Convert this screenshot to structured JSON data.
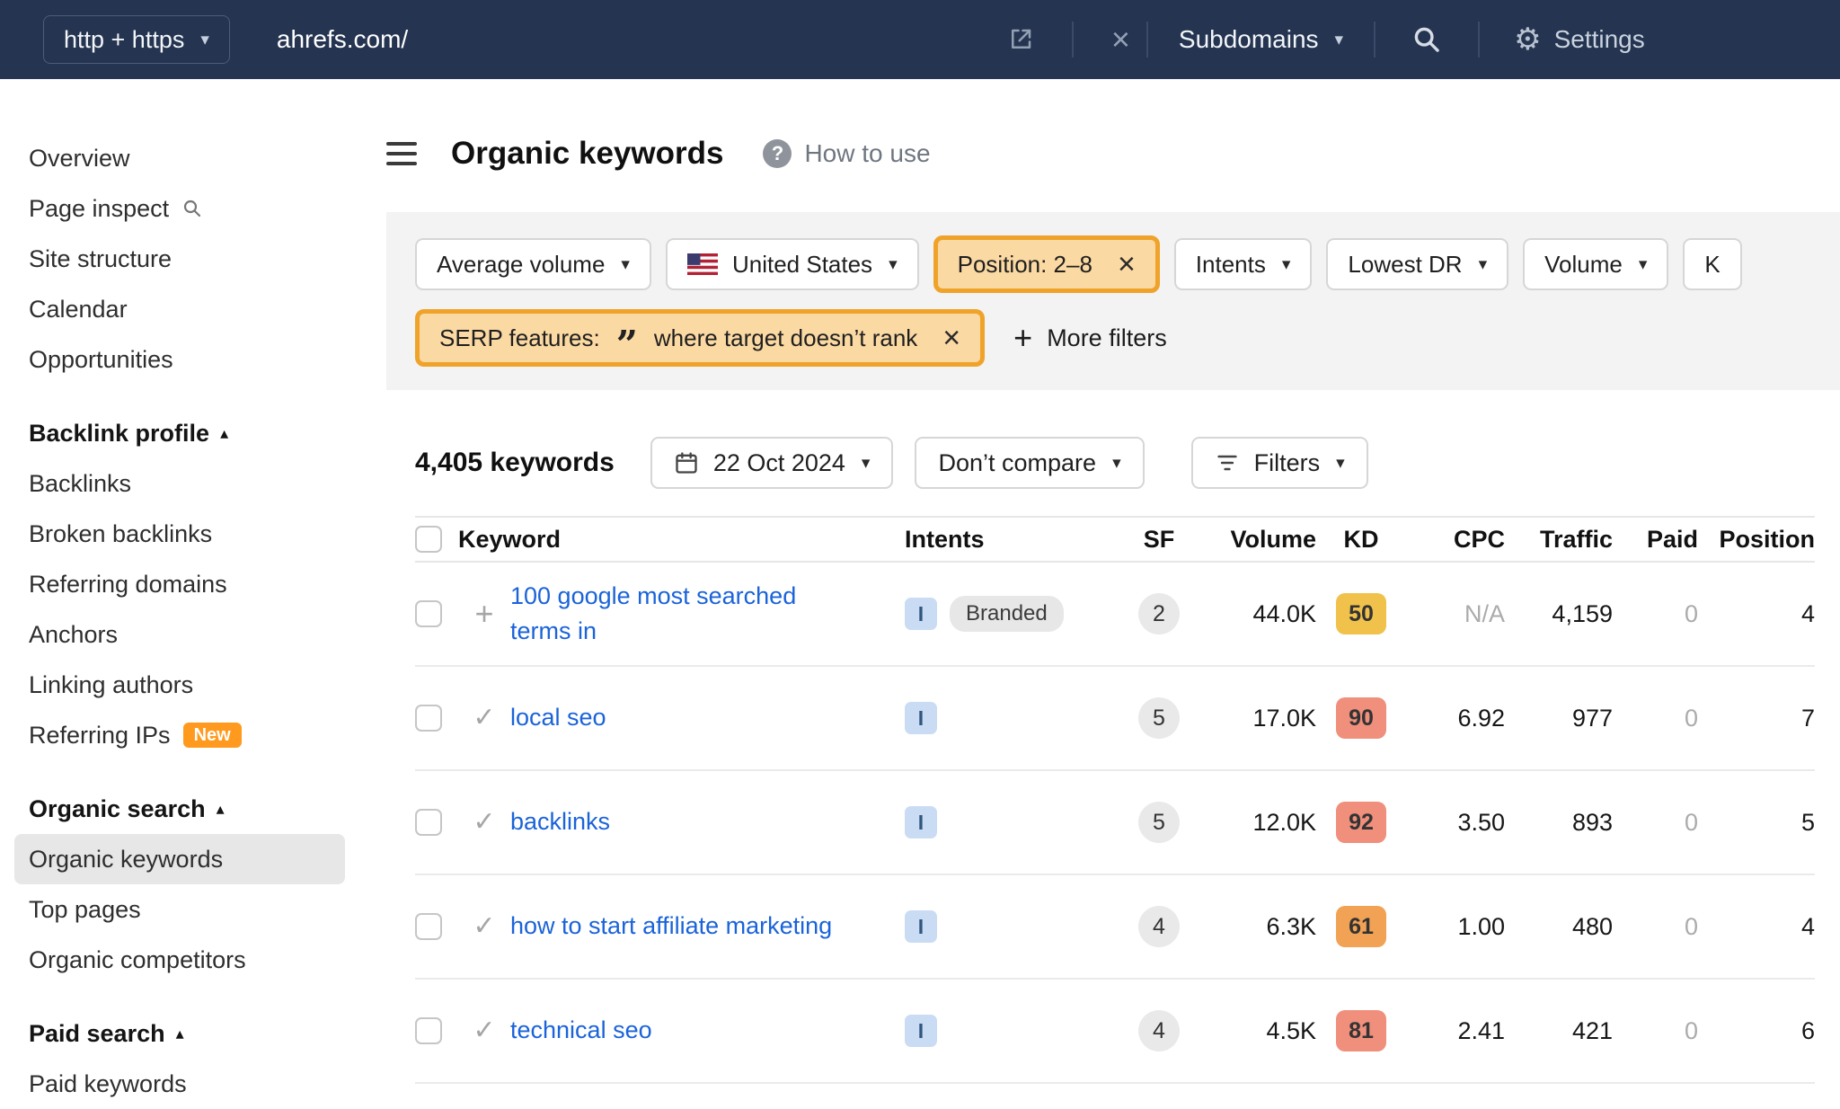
{
  "topbar": {
    "protocol_selector": "http + https",
    "target": "ahrefs.com/",
    "scope_selector": "Subdomains",
    "settings_label": "Settings"
  },
  "page": {
    "title": "Organic keywords",
    "help_label": "How to use"
  },
  "sidebar": {
    "groups": [
      {
        "items": [
          {
            "label": "Overview"
          },
          {
            "label": "Page inspect"
          },
          {
            "label": "Site structure"
          },
          {
            "label": "Calendar"
          },
          {
            "label": "Opportunities"
          }
        ]
      },
      {
        "header": "Backlink profile",
        "items": [
          {
            "label": "Backlinks"
          },
          {
            "label": "Broken backlinks"
          },
          {
            "label": "Referring domains"
          },
          {
            "label": "Anchors"
          },
          {
            "label": "Linking authors"
          },
          {
            "label": "Referring IPs",
            "badge": "New"
          }
        ]
      },
      {
        "header": "Organic search",
        "items": [
          {
            "label": "Organic keywords",
            "selected": true
          },
          {
            "label": "Top pages"
          },
          {
            "label": "Organic competitors"
          }
        ]
      },
      {
        "header": "Paid search",
        "items": [
          {
            "label": "Paid keywords"
          }
        ]
      }
    ]
  },
  "filters": {
    "average_volume": "Average volume",
    "country": "United States",
    "position": "Position: 2–8",
    "intents": "Intents",
    "lowest_dr": "Lowest DR",
    "volume": "Volume",
    "clipped_chip": "K",
    "serp_prefix": "SERP features:",
    "serp_value": "where target doesn’t rank",
    "more_filters": "More filters"
  },
  "controls": {
    "keywords_count": "4,405 keywords",
    "date": "22 Oct 2024",
    "compare": "Don’t compare",
    "filters": "Filters"
  },
  "table": {
    "columns": {
      "keyword": "Keyword",
      "intents": "Intents",
      "sf": "SF",
      "volume": "Volume",
      "kd": "KD",
      "cpc": "CPC",
      "traffic": "Traffic",
      "paid": "Paid",
      "position": "Position"
    },
    "rows": [
      {
        "keyword": "100 google most searched terms in",
        "intent": "I",
        "intent_label": "Branded",
        "sf": "2",
        "volume": "44.0K",
        "kd": "50",
        "cpc": "N/A",
        "traffic": "4,159",
        "paid": "0",
        "position": "4"
      },
      {
        "keyword": "local seo",
        "intent": "I",
        "sf": "5",
        "volume": "17.0K",
        "kd": "90",
        "cpc": "6.92",
        "traffic": "977",
        "paid": "0",
        "position": "7"
      },
      {
        "keyword": "backlinks",
        "intent": "I",
        "sf": "5",
        "volume": "12.0K",
        "kd": "92",
        "cpc": "3.50",
        "traffic": "893",
        "paid": "0",
        "position": "5"
      },
      {
        "keyword": "how to start affiliate marketing",
        "intent": "I",
        "sf": "4",
        "volume": "6.3K",
        "kd": "61",
        "cpc": "1.00",
        "traffic": "480",
        "paid": "0",
        "position": "4"
      },
      {
        "keyword": "technical seo",
        "intent": "I",
        "sf": "4",
        "volume": "4.5K",
        "kd": "81",
        "cpc": "2.41",
        "traffic": "421",
        "paid": "0",
        "position": "6"
      }
    ]
  },
  "icons": {
    "caret_down": "▾",
    "caret_up": "▴",
    "close": "×",
    "check": "✓",
    "plus": "+",
    "question": "?",
    "gear": "⚙",
    "quote": "”"
  },
  "colors": {
    "topbar_bg": "#253450",
    "accent_orange": "#f0a32b",
    "active_filter_bg": "#fbd9a3",
    "link_blue": "#1a63d9",
    "kd_medium": "#f0c24b",
    "kd_hard": "#f2a254",
    "kd_super_hard": "#ef8f7c",
    "new_badge": "#ff9a1f",
    "intent_badge_bg": "#cadcf3"
  }
}
